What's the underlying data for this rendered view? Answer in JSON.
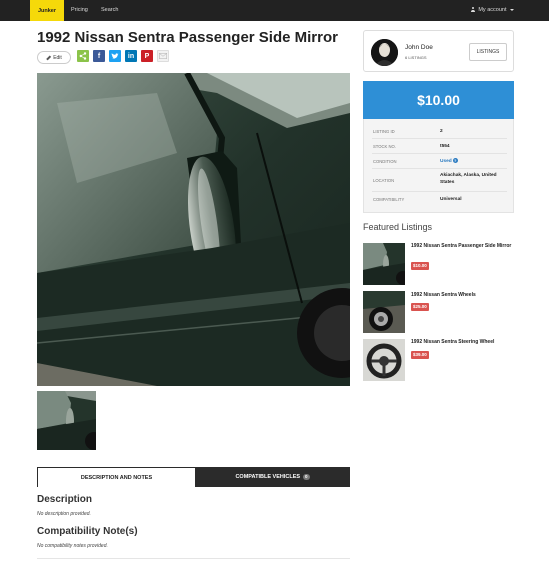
{
  "navbar": {
    "brand": "Junker",
    "links": [
      "Pricing",
      "Search"
    ],
    "account": "My account"
  },
  "listing": {
    "title": "1992 Nissan Sentra Passenger Side Mirror",
    "edit_label": "Edit",
    "share_icons": [
      "share-icon",
      "facebook-icon",
      "twitter-icon",
      "linkedin-icon",
      "pinterest-icon",
      "email-icon"
    ]
  },
  "tabs": {
    "description_label": "DESCRIPTION AND NOTES",
    "compatible_label": "COMPATIBLE VEHICLES",
    "compatible_count": "0"
  },
  "description": {
    "heading": "Description",
    "text": "No description provided."
  },
  "compatibility": {
    "heading": "Compatibility Note(s)",
    "text": "No compatibility notes provided."
  },
  "seller": {
    "name": "John Doe",
    "listings_count": "6 LISTINGS",
    "listings_button": "LISTINGS"
  },
  "price": "$10.00",
  "details": [
    {
      "key": "LISTING ID",
      "value": "2"
    },
    {
      "key": "STOCK NO.",
      "value": "t554"
    },
    {
      "key": "CONDITION",
      "value": "Used"
    },
    {
      "key": "LOCATION",
      "value": "Akiachak, Alaska, United States"
    },
    {
      "key": "COMPATIBILITY",
      "value": "Universal"
    }
  ],
  "featured": {
    "heading": "Featured Listings",
    "items": [
      {
        "title": "1992 Nissan Sentra Passenger Side Mirror",
        "price": "$10.00"
      },
      {
        "title": "1992 Nissan Sentra Wheels",
        "price": "$25.00"
      },
      {
        "title": "1992 Nissan Sentra Steering Wheel",
        "price": "$39.00"
      }
    ]
  },
  "colors": {
    "brand_yellow": "#f5d90a",
    "navbar": "#222222",
    "price_blue": "#2e8fd6",
    "price_badge_red": "#d9534f",
    "link_blue": "#2a7ac0"
  }
}
